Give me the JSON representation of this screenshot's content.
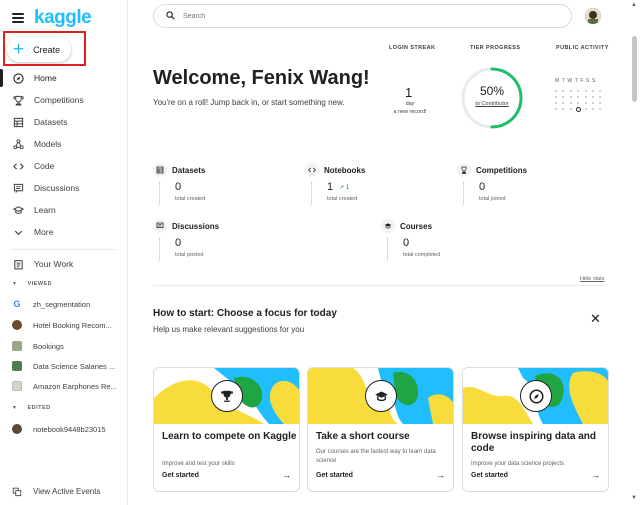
{
  "brand": {
    "logo": "kaggle",
    "accent": "#20beff"
  },
  "sidebar": {
    "create_label": "Create",
    "items": [
      {
        "label": "Home",
        "icon": "compass-icon"
      },
      {
        "label": "Competitions",
        "icon": "trophy-icon"
      },
      {
        "label": "Datasets",
        "icon": "table-icon"
      },
      {
        "label": "Models",
        "icon": "models-icon"
      },
      {
        "label": "Code",
        "icon": "code-icon"
      },
      {
        "label": "Discussions",
        "icon": "discussion-icon"
      },
      {
        "label": "Learn",
        "icon": "graduation-cap-icon"
      },
      {
        "label": "More",
        "icon": "chevron-down-icon"
      }
    ],
    "your_work": "Your Work",
    "viewed_label": "VIEWED",
    "viewed": [
      "zh_segmentation",
      "Hotel Booking Recom...",
      "Bookings",
      "Data Science Salaries ...",
      "Amazon Earphones Re..."
    ],
    "edited_label": "EDITED",
    "edited": [
      "notebook9448b23015"
    ],
    "view_events": "View Active Events"
  },
  "search": {
    "placeholder": "Search"
  },
  "welcome": {
    "title": "Welcome, Fenix Wang!",
    "subtitle": "You're on a roll! Jump back in, or start something new."
  },
  "login_streak": {
    "label": "LOGIN STREAK",
    "value": "1",
    "unit": "day",
    "note": "a new record!"
  },
  "tier_progress": {
    "label": "TIER PROGRESS",
    "percent": 50,
    "percent_text": "50%",
    "target": "to Contributor"
  },
  "public_activity": {
    "label": "PUBLIC ACTIVITY",
    "days": "MTWTFSS"
  },
  "stats": {
    "datasets": {
      "title": "Datasets",
      "value": "0",
      "caption": "total created"
    },
    "notebooks": {
      "title": "Notebooks",
      "value": "1",
      "trend": "1",
      "caption": "total created"
    },
    "competitions": {
      "title": "Competitions",
      "value": "0",
      "caption": "total joined"
    },
    "discussions": {
      "title": "Discussions",
      "value": "0",
      "caption": "total posted"
    },
    "courses": {
      "title": "Courses",
      "value": "0",
      "caption": "total completed"
    },
    "hide": "Hide stats"
  },
  "how_to_start": {
    "title": "How to start: Choose a focus for today",
    "subtitle": "Help us make relevant suggestions for you"
  },
  "cards": [
    {
      "title": "Learn to compete on Kaggle",
      "desc": "Improve and test your skills",
      "cta": "Get started",
      "icon": "trophy-icon"
    },
    {
      "title": "Take a short course",
      "desc": "Our courses are the fastest way to learn data science",
      "cta": "Get started",
      "icon": "graduation-cap-icon"
    },
    {
      "title": "Browse inspiring data and code",
      "desc": "Improve your data science projects",
      "cta": "Get started",
      "icon": "compass-icon"
    }
  ]
}
